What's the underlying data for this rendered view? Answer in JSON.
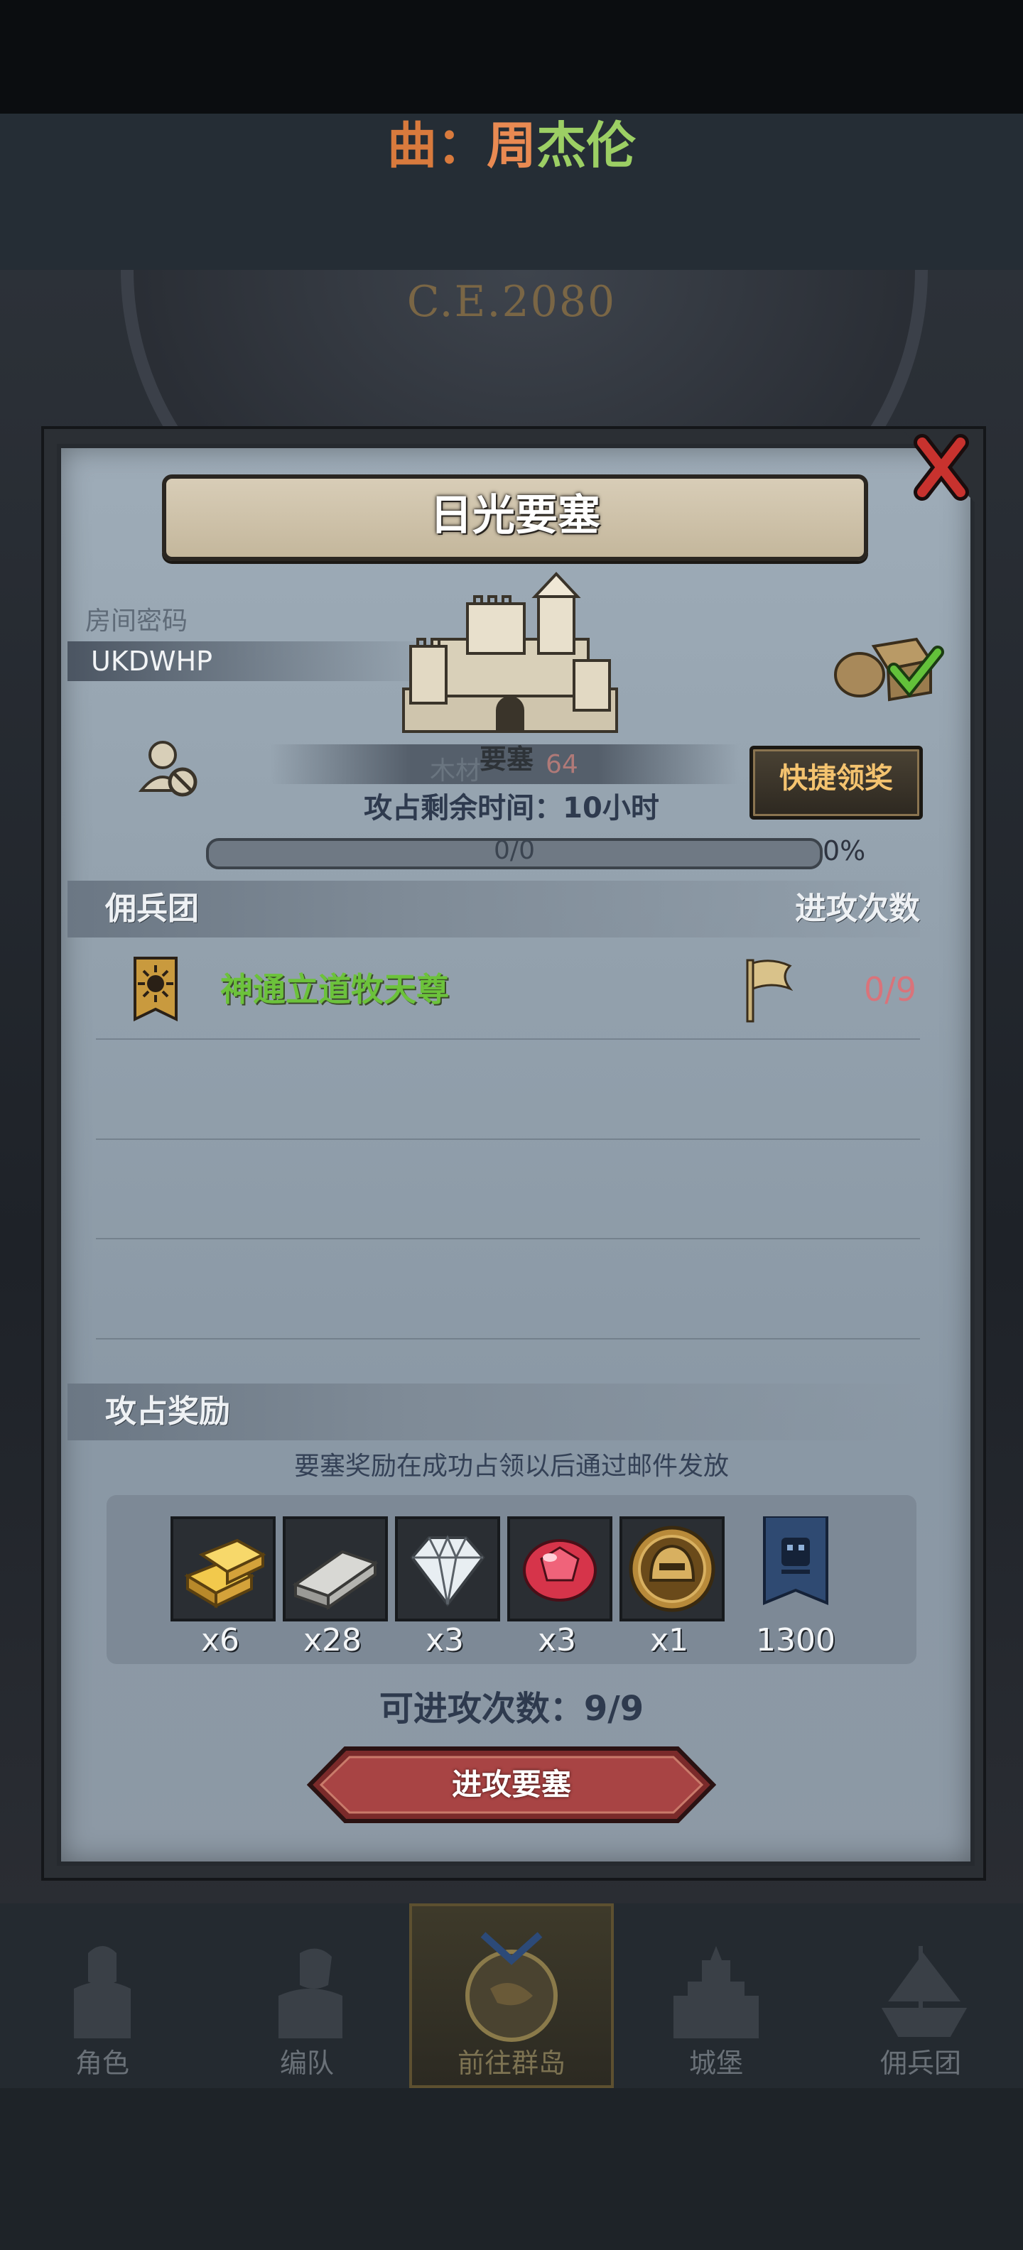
{
  "caption": {
    "part1": "曲：",
    "part2": "周",
    "part3": "杰伦"
  },
  "background": {
    "year": "C.E.2080"
  },
  "dialog": {
    "title": "日光要塞",
    "room_password_label": "房间密码",
    "room_password": "UKDWHP",
    "castle": {
      "resource_label": "木材",
      "resource_value": "64",
      "type_label": "要塞"
    },
    "quick_claim_button": "快捷领奖",
    "remaining_time": "攻占剩余时间：10小时",
    "progress": {
      "text": "0/0",
      "percent_text": "0%",
      "fraction": 0
    },
    "mercenary_section": {
      "title": "佣兵团",
      "column_attacks": "进攻次数"
    },
    "mercenaries": [
      {
        "name": "神通立道牧天尊",
        "attacks": "0/9"
      }
    ],
    "reward_section": {
      "title": "攻占奖励",
      "note": "要塞奖励在成功占领以后通过邮件发放",
      "items": [
        {
          "icon": "gold-bar-icon",
          "count": "x6"
        },
        {
          "icon": "iron-ingot-icon",
          "count": "x28"
        },
        {
          "icon": "diamond-icon",
          "count": "x3"
        },
        {
          "icon": "ruby-icon",
          "count": "x3"
        },
        {
          "icon": "helmet-medal-icon",
          "count": "x1"
        },
        {
          "icon": "guild-banner-icon",
          "count": "1300"
        }
      ]
    },
    "attackable_times": "可进攻次数：9/9",
    "attack_button": "进攻要塞"
  },
  "nav": {
    "items": [
      {
        "label": "角色",
        "icon": "knight-icon"
      },
      {
        "label": "编队",
        "icon": "squad-icon"
      },
      {
        "label": "前往群岛",
        "icon": "compass-icon",
        "active": true
      },
      {
        "label": "城堡",
        "icon": "castle-icon"
      },
      {
        "label": "佣兵团",
        "icon": "ship-icon"
      }
    ]
  },
  "colors": {
    "mercenary_name": "#6cc23b",
    "attack_count": "#d9737a",
    "quick_button_text": "#f4c36f",
    "caption_orange": "#d87a3d",
    "caption_green": "#9ccf64"
  }
}
